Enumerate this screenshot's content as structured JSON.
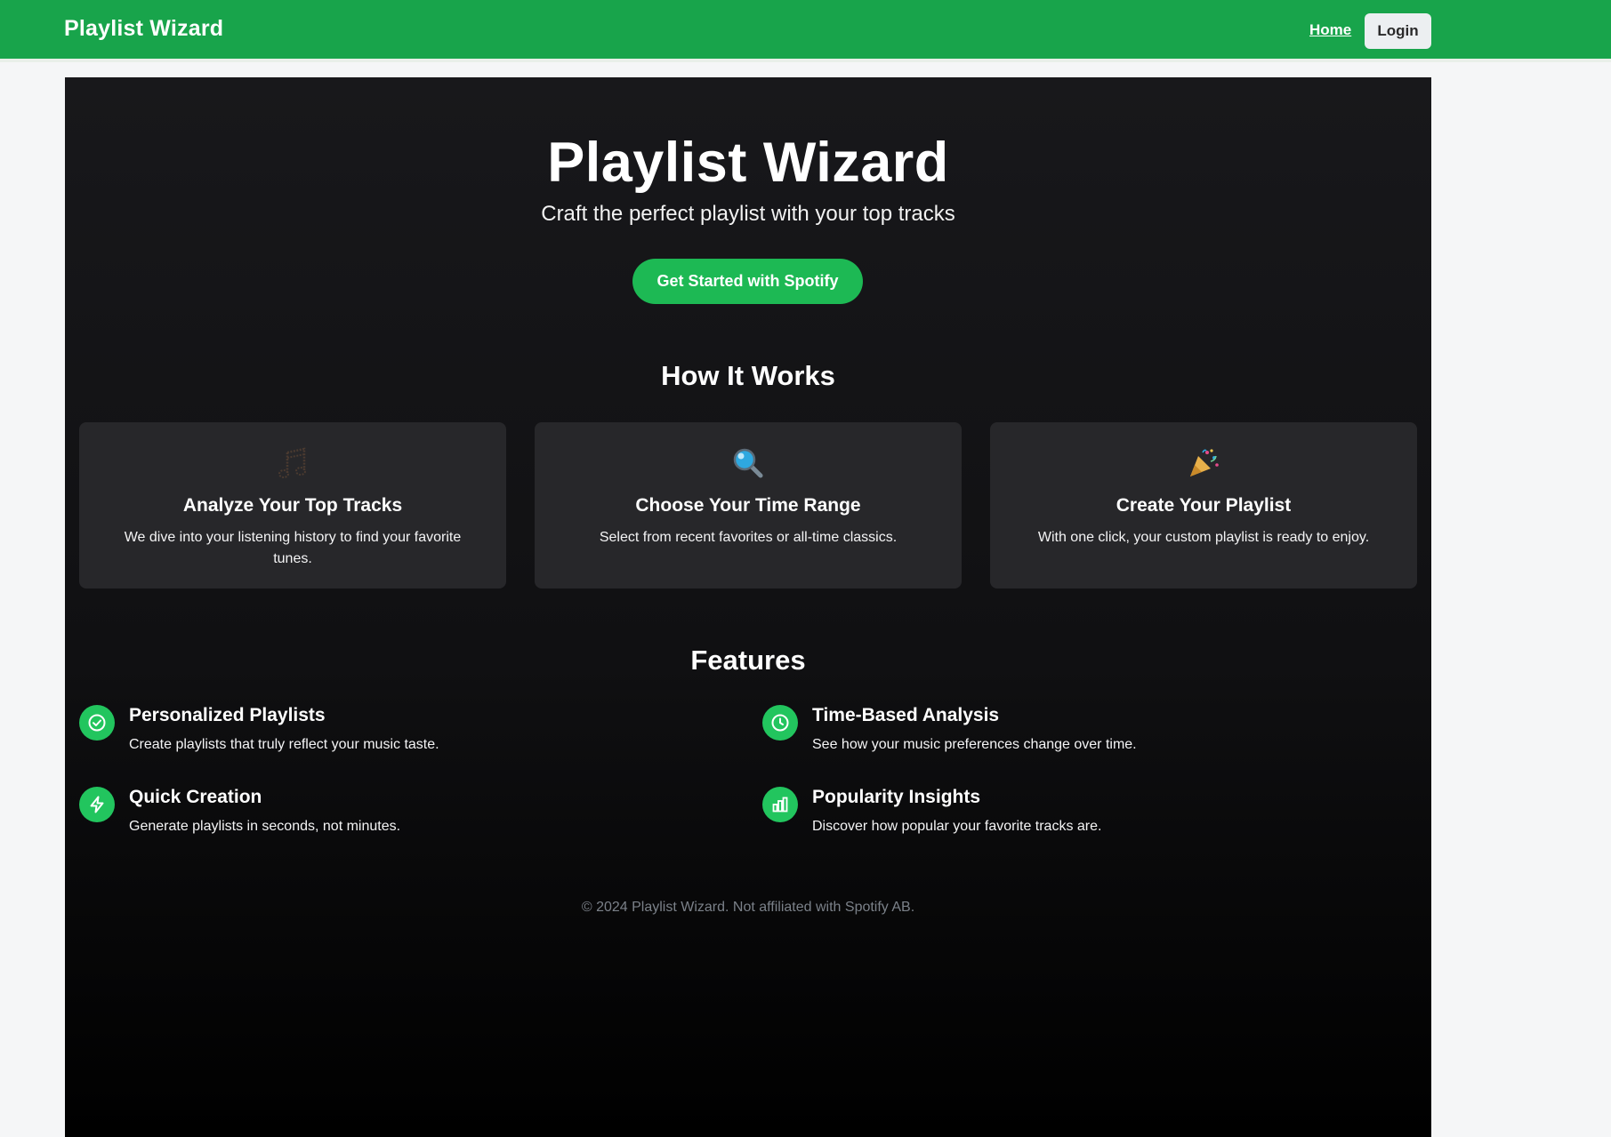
{
  "navbar": {
    "brand": "Playlist Wizard",
    "home_label": "Home",
    "login_label": "Login"
  },
  "hero": {
    "title": "Playlist Wizard",
    "subtitle": "Craft the perfect playlist with your top tracks",
    "cta_label": "Get Started with Spotify"
  },
  "how_it_works": {
    "title": "How It Works",
    "steps": [
      {
        "icon": "musical-notes-icon",
        "title": "Analyze Your Top Tracks",
        "description": "We dive into your listening history to find your favorite tunes."
      },
      {
        "icon": "magnifying-glass-icon",
        "title": "Choose Your Time Range",
        "description": "Select from recent favorites or all-time classics."
      },
      {
        "icon": "party-popper-icon",
        "title": "Create Your Playlist",
        "description": "With one click, your custom playlist is ready to enjoy."
      }
    ]
  },
  "features": {
    "title": "Features",
    "items": [
      {
        "icon": "check-circle-icon",
        "title": "Personalized Playlists",
        "description": "Create playlists that truly reflect your music taste."
      },
      {
        "icon": "clock-icon",
        "title": "Time-Based Analysis",
        "description": "See how your music preferences change over time."
      },
      {
        "icon": "lightning-bolt-icon",
        "title": "Quick Creation",
        "description": "Generate playlists in seconds, not minutes."
      },
      {
        "icon": "bar-chart-icon",
        "title": "Popularity Insights",
        "description": "Discover how popular your favorite tracks are."
      }
    ]
  },
  "footer": {
    "text": "© 2024 Playlist Wizard. Not affiliated with Spotify AB."
  },
  "colors": {
    "header_green": "#18a44b",
    "accent_green": "#1db954",
    "card_bg": "#27272a",
    "panel_bg": "#18181b"
  }
}
